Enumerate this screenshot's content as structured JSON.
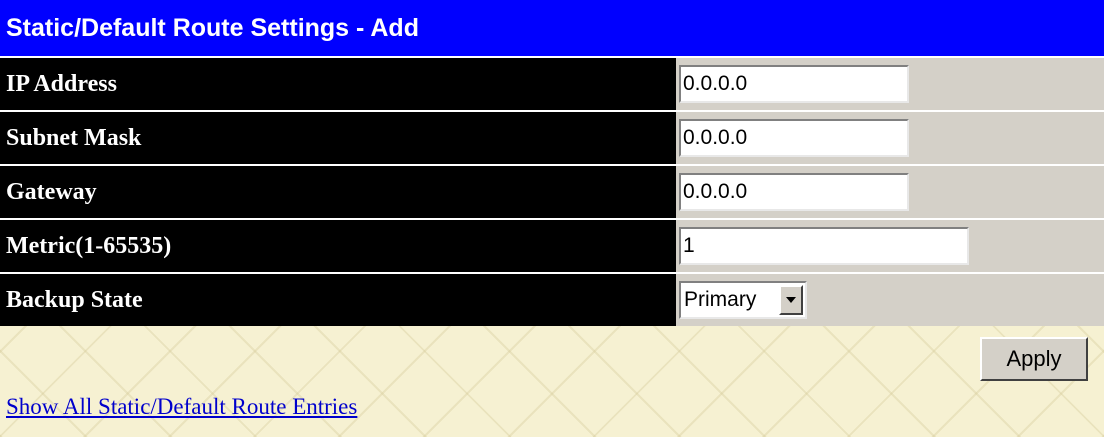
{
  "header": {
    "title": "Static/Default Route Settings - Add"
  },
  "form": {
    "ip_address": {
      "label": "IP Address",
      "value": "0.0.0.0"
    },
    "subnet_mask": {
      "label": "Subnet Mask",
      "value": "0.0.0.0"
    },
    "gateway": {
      "label": "Gateway",
      "value": "0.0.0.0"
    },
    "metric": {
      "label": "Metric(1-65535)",
      "value": "1"
    },
    "backup_state": {
      "label": "Backup State",
      "selected": "Primary"
    }
  },
  "actions": {
    "apply_label": "Apply"
  },
  "links": {
    "show_all": "Show All Static/Default Route Entries"
  },
  "colors": {
    "title_bar": "#0000ff",
    "label_cell": "#000000",
    "value_cell": "#d4d0c8",
    "background": "#f6f1d2",
    "link": "#0000cc"
  },
  "icons": {
    "dropdown": "chevron-down-icon"
  }
}
